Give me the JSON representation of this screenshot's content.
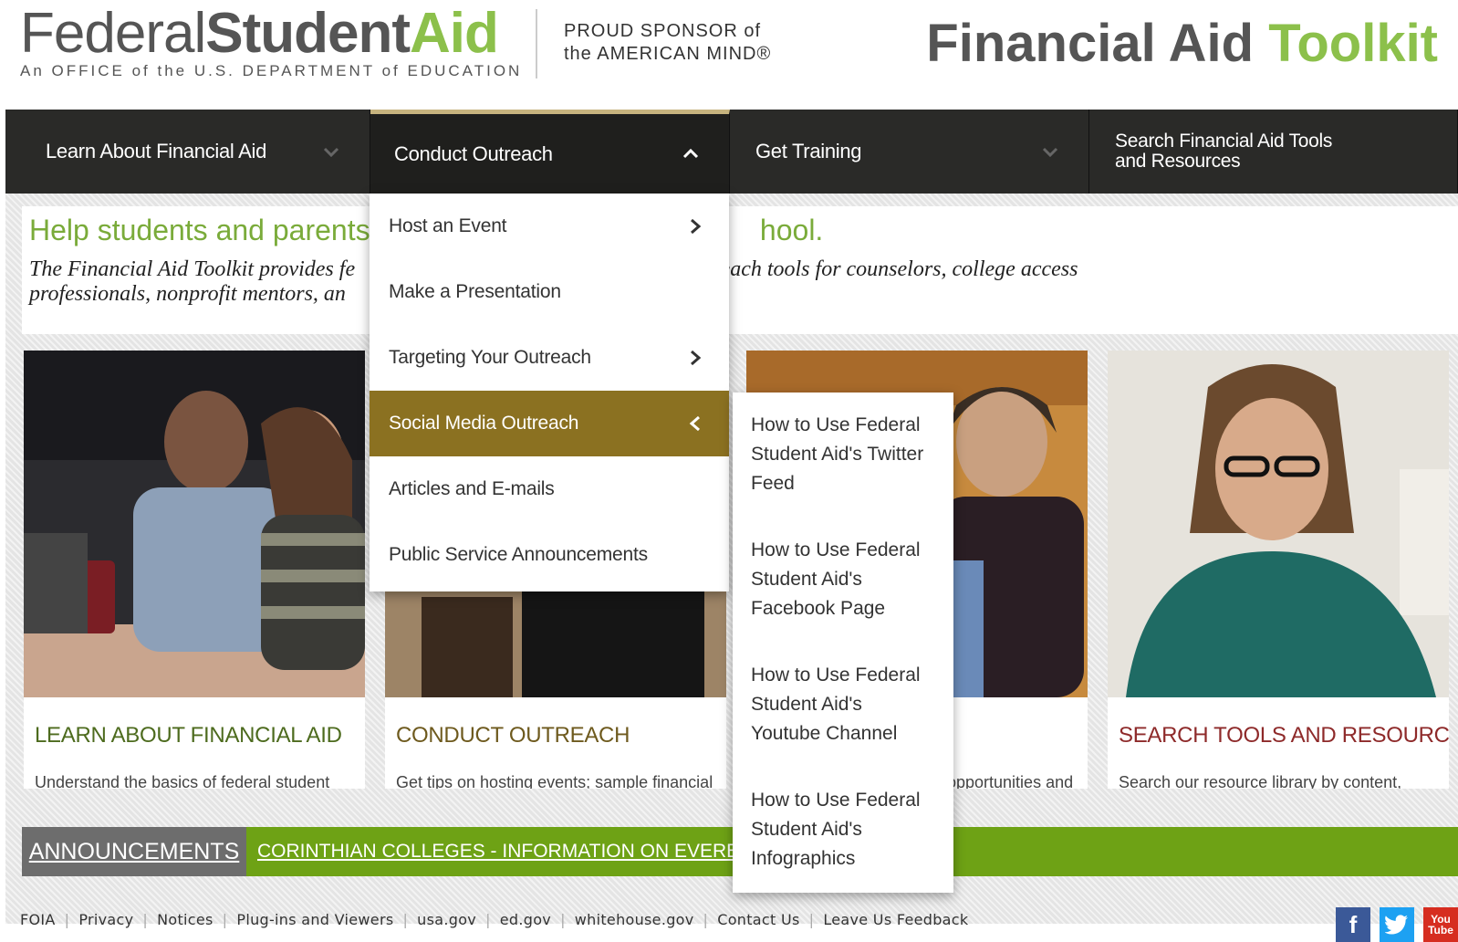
{
  "header": {
    "logo_federal": "Federal",
    "logo_student": "Student",
    "logo_aid": "Aid",
    "logo_tagline": "An OFFICE of the U.S. DEPARTMENT of EDUCATION",
    "sponsor_line1": "PROUD SPONSOR of",
    "sponsor_line2": "the AMERICAN MIND®",
    "toolkit_part1": "Financial Aid",
    "toolkit_part2": "Toolkit"
  },
  "nav": {
    "items": [
      {
        "label": "Learn About Financial Aid"
      },
      {
        "label": "Conduct Outreach"
      },
      {
        "label": "Get Training"
      },
      {
        "label": "Search Financial Aid Tools and Resources"
      }
    ]
  },
  "intro": {
    "heading": "Help students and parents pr",
    "heading_tail": "hool.",
    "text_a": "The Financial Aid Toolkit provides fe",
    "text_b": "reach tools for counselors, college access",
    "text_c": "professionals, nonprofit mentors, an"
  },
  "cards": [
    {
      "title": "LEARN ABOUT FINANCIAL AID",
      "desc": "Understand the basics of federal student aid, the FAFSA, and loan repayment"
    },
    {
      "title": "CONDUCT OUTREACH",
      "desc": "Get tips on hosting events; sample financial aid night PowerPoint presentations; and"
    },
    {
      "title": "",
      "desc": "opportunities and ining for"
    },
    {
      "title": "SEARCH TOOLS AND RESOURCES",
      "desc": "Search our resource library by content, audience, topic, and time of year"
    }
  ],
  "announcements": {
    "label": "ANNOUNCEMENTS",
    "link": "CORINTHIAN COLLEGES - INFORMATION ON EVEREST HEALT"
  },
  "dropdown": {
    "items": [
      {
        "label": "Host an Event"
      },
      {
        "label": "Make a Presentation"
      },
      {
        "label": "Targeting Your Outreach"
      },
      {
        "label": "Social Media Outreach"
      },
      {
        "label": "Articles and E-mails"
      },
      {
        "label": "Public Service Announcements"
      }
    ]
  },
  "submenu": {
    "items": [
      {
        "label": "How to Use Federal Student Aid's Twitter Feed"
      },
      {
        "label": "How to Use Federal Student Aid's Facebook Page"
      },
      {
        "label": "How to Use Federal Student Aid's Youtube Channel"
      },
      {
        "label": "How to Use Federal Student Aid's Infographics"
      }
    ]
  },
  "footer": {
    "links": [
      "FOIA",
      "Privacy",
      "Notices",
      "Plug-ins and Viewers",
      "usa.gov",
      "ed.gov",
      "whitehouse.gov",
      "Contact Us",
      "Leave Us Feedback"
    ]
  },
  "social": {
    "facebook": "f",
    "youtube_top": "You",
    "youtube_bottom": "Tube"
  },
  "colors": {
    "nav_bg": "#2a2a28",
    "accent_gold": "#8b7121",
    "brand_green": "#8cc04b",
    "announce_green": "#6ea215"
  }
}
